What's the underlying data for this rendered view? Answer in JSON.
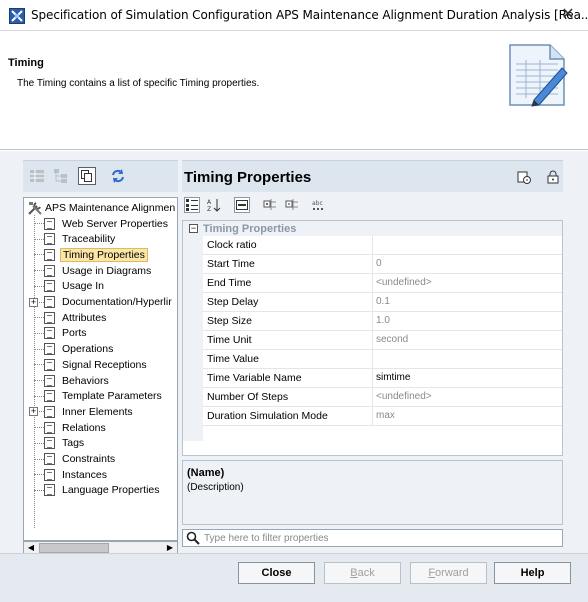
{
  "window": {
    "title": "Specification of Simulation Configuration APS Maintenance Alignment Duration Analysis [Rea...",
    "close_glyph": "✕"
  },
  "header": {
    "title": "Timing",
    "description": "The Timing contains a list of specific Timing properties."
  },
  "tree": {
    "root_label": "APS Maintenance Alignmen",
    "items": [
      {
        "label": "Web Server Properties",
        "expandable": false
      },
      {
        "label": "Traceability",
        "expandable": false
      },
      {
        "label": "Timing Properties",
        "expandable": false,
        "selected": true
      },
      {
        "label": "Usage in Diagrams",
        "expandable": false
      },
      {
        "label": "Usage In",
        "expandable": false
      },
      {
        "label": "Documentation/Hyperlir",
        "expandable": true
      },
      {
        "label": "Attributes",
        "expandable": false
      },
      {
        "label": "Ports",
        "expandable": false
      },
      {
        "label": "Operations",
        "expandable": false
      },
      {
        "label": "Signal Receptions",
        "expandable": false
      },
      {
        "label": "Behaviors",
        "expandable": false
      },
      {
        "label": "Template Parameters",
        "expandable": false
      },
      {
        "label": "Inner Elements",
        "expandable": true
      },
      {
        "label": "Relations",
        "expandable": false
      },
      {
        "label": "Tags",
        "expandable": false
      },
      {
        "label": "Constraints",
        "expandable": false
      },
      {
        "label": "Instances",
        "expandable": false
      },
      {
        "label": "Language Properties",
        "expandable": false
      }
    ]
  },
  "properties": {
    "title": "Timing Properties",
    "group_name": "Timing Properties",
    "rows": [
      {
        "name": "Clock ratio",
        "value": "",
        "strong": false
      },
      {
        "name": "Start Time",
        "value": "0",
        "strong": false
      },
      {
        "name": "End Time",
        "value": "<undefined>",
        "strong": false
      },
      {
        "name": "Step Delay",
        "value": "0.1",
        "strong": false
      },
      {
        "name": "Step Size",
        "value": "1.0",
        "strong": false
      },
      {
        "name": "Time Unit",
        "value": "second",
        "strong": false
      },
      {
        "name": "Time Value",
        "value": "",
        "strong": false
      },
      {
        "name": "Time Variable Name",
        "value": "simtime",
        "strong": true
      },
      {
        "name": "Number Of Steps",
        "value": "<undefined>",
        "strong": false
      },
      {
        "name": "Duration Simulation Mode",
        "value": "max",
        "strong": false
      }
    ]
  },
  "description_pane": {
    "name": "(Name)",
    "description": "(Description)"
  },
  "filter": {
    "placeholder": "Type here to filter properties",
    "value": ""
  },
  "buttons": {
    "close": "Close",
    "back_prefix": "",
    "back_mnemonic": "B",
    "back_rest": "ack",
    "forward_mnemonic": "F",
    "forward_rest": "orward",
    "help": "Help"
  }
}
